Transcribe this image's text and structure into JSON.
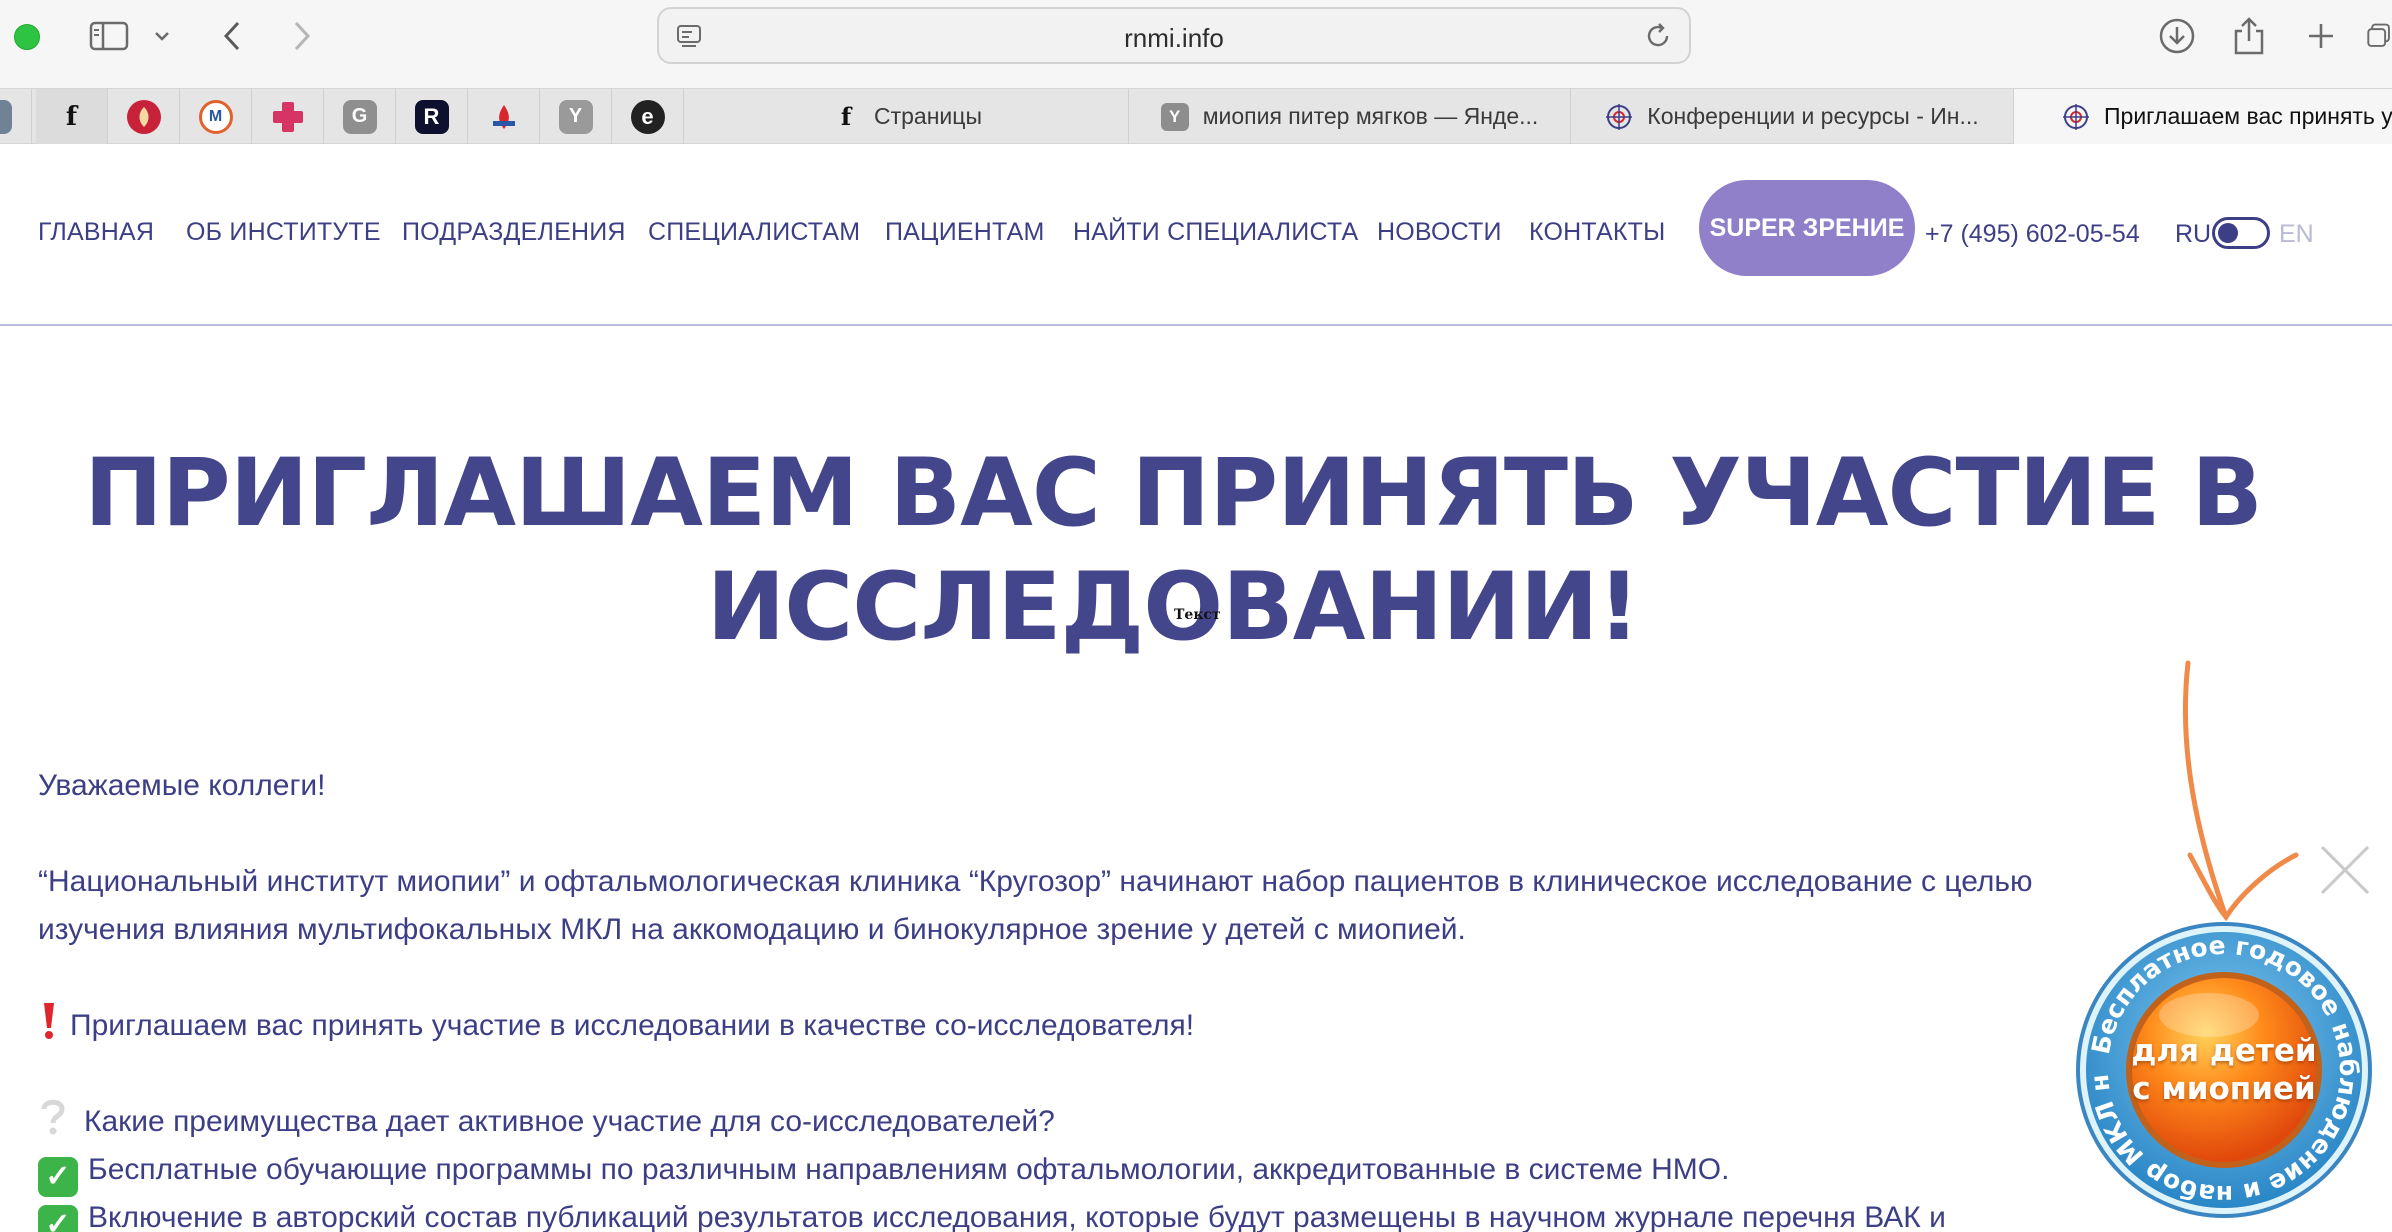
{
  "browser": {
    "url": "rnmi.info",
    "tabs": [
      {
        "label": "Страницы"
      },
      {
        "label": "миопия питер мягков — Янде..."
      },
      {
        "label": "Конференции и ресурсы - Ин..."
      },
      {
        "label": "Приглашаем вас принять у"
      }
    ],
    "pinned_tabs": [
      "facebook-favicon",
      "redbull-favicon",
      "mirea-favicon",
      "medical-cross-favicon",
      "g-favicon",
      "r-favicon",
      "ophtal-favicon",
      "yandex-favicon",
      "e-favicon"
    ]
  },
  "nav": {
    "items": [
      "ГЛАВНАЯ",
      "ОБ ИНСТИТУТЕ",
      "ПОДРАЗДЕЛЕНИЯ",
      "СПЕЦИАЛИСТАМ",
      "ПАЦИЕНТАМ",
      "НАЙТИ СПЕЦИАЛИСТА",
      "НОВОСТИ",
      "КОНТАКТЫ"
    ],
    "super_button": "SUPER ЗРЕНИЕ",
    "phone": "+7 (495) 602-05-54",
    "lang_ru": "RU",
    "lang_en": "EN"
  },
  "main": {
    "title_line1": "ПРИГЛАШАЕМ ВАС ПРИНЯТЬ УЧАСТИЕ В",
    "title_line2": "ИССЛЕДОВАНИИ!",
    "tooltip": "Текст",
    "greeting": "Уважаемые коллеги!",
    "intro_line1": "“Национальный институт миопии” и офтальмологическая клиника “Кругозор” начинают набор пациентов в клиническое исследование с целью",
    "intro_line2": "изучения влияния мультифокальных МКЛ на аккомодацию и бинокулярное зрение у детей с миопией.",
    "invite": "Приглашаем вас принять участие в исследовании в качестве со-исследователя!",
    "question": "Какие преимущества дает активное участие для со-исследователей?",
    "benefit1": "Бесплатные обучающие программы по различным направлениям офтальмологии, аккредитованные в системе НМО.",
    "benefit2": "Включение в авторский состав публикаций результатов исследования, которые будут размещены в научном журнале перечня ВАК и"
  },
  "promo": {
    "ring_text": "Бесплатное годовое наблюдение и набор МКЛ на год",
    "center_line1": "для детей",
    "center_line2": "с миопией"
  },
  "colors": {
    "brand": "#3d3f86",
    "super_button": "#8f80c9",
    "arrow": "#ef8a48",
    "check": "#3cb44a"
  }
}
